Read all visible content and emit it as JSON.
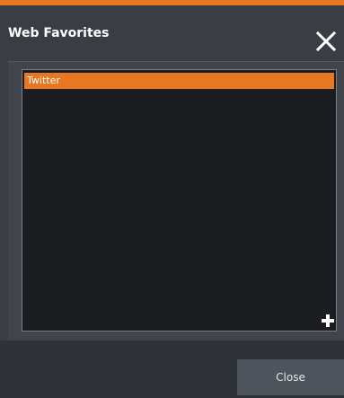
{
  "dialog": {
    "title": "Web Favorites",
    "close_icon": "close-x-icon"
  },
  "favorites": {
    "items": [
      {
        "label": "Twitter",
        "selected": true
      }
    ],
    "add_icon": "plus-icon"
  },
  "footer": {
    "close_label": "Close"
  },
  "colors": {
    "accent": "#e87722",
    "background": "#3a3e44",
    "list_background": "#1b1d20",
    "button": "#4e545c"
  }
}
